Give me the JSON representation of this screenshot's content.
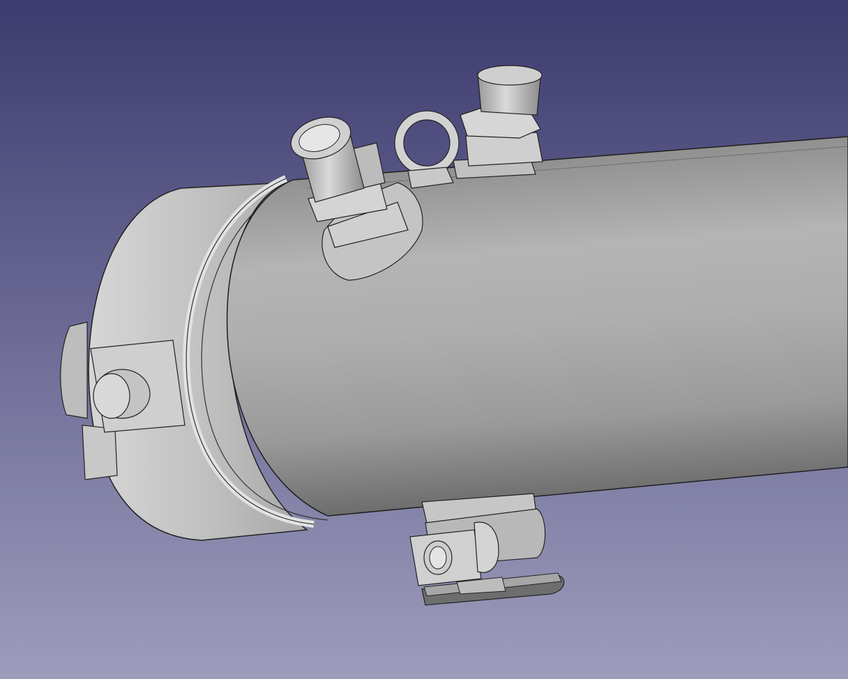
{
  "viewport": {
    "background_top": "#3d3b6f",
    "background_bottom": "#9d9cbc",
    "model_fill": "#b8b8b8",
    "model_light": "#d8d8d8",
    "model_dark": "#6a6a6a",
    "edge_color": "#202020"
  },
  "model": {
    "parts": [
      "cylinder-body-icon",
      "end-cap-icon",
      "hose-fitting-icon",
      "eye-bolt-icon",
      "threaded-fitting-icon",
      "bottom-valve-icon"
    ]
  }
}
